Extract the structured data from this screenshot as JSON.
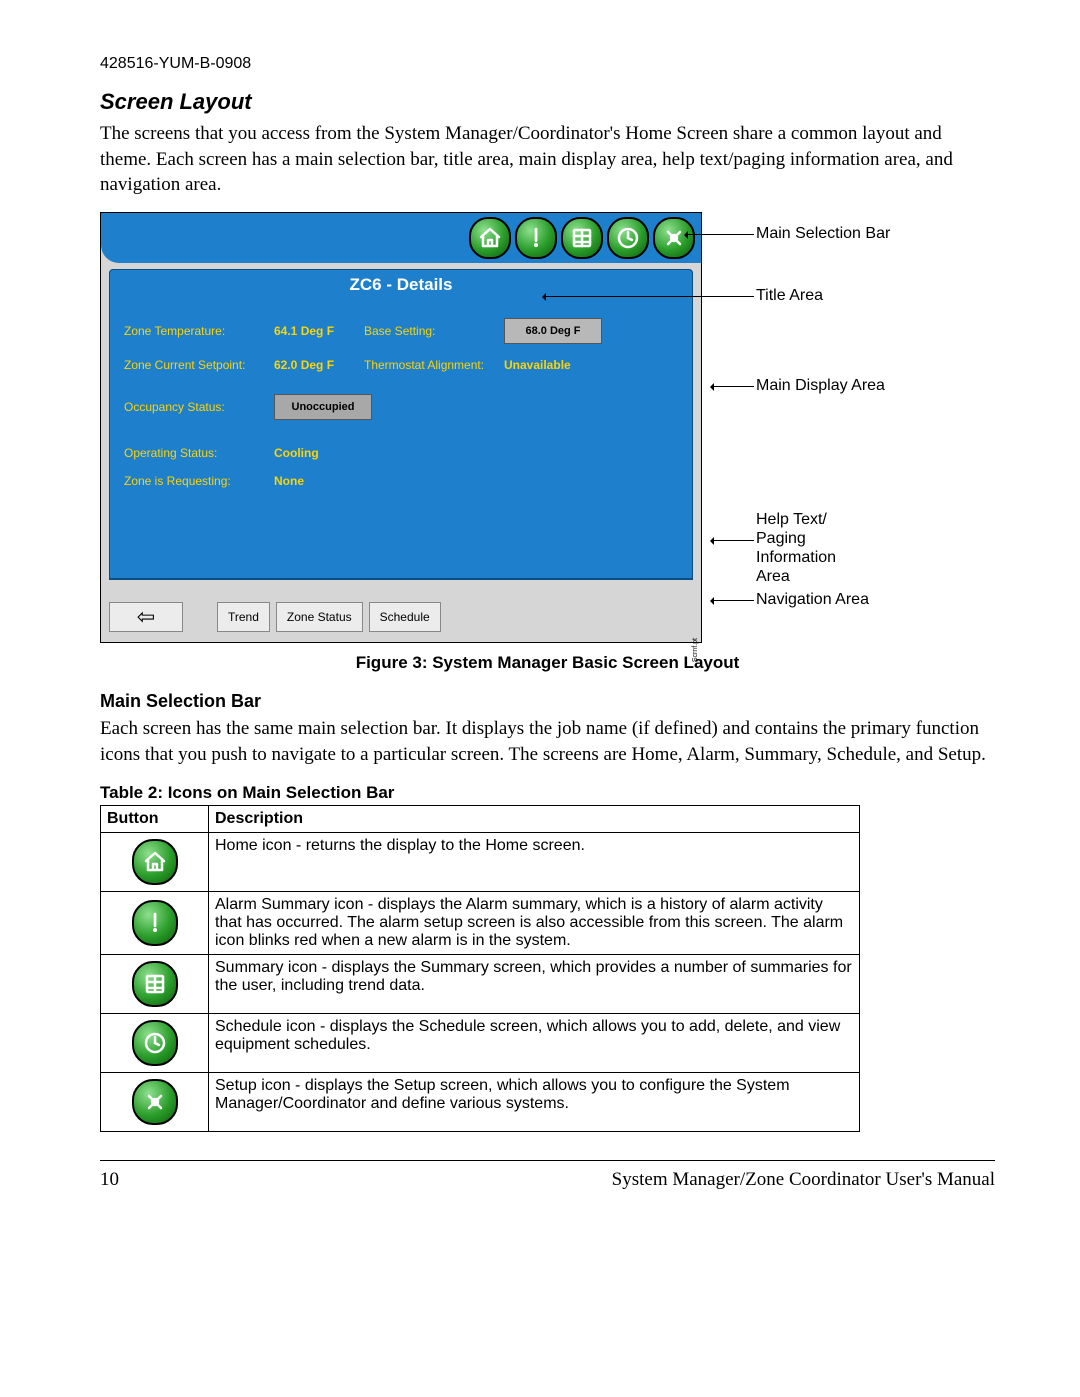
{
  "doc_header": "428516-YUM-B-0908",
  "section_heading": "Screen Layout",
  "intro_paragraph": "The screens that you access from the System Manager/Coordinator's Home Screen share a common layout and theme. Each screen has a main selection bar, title area, main display area, help text/paging information area, and navigation area.",
  "figure": {
    "title_bar_text": "ZC6 - Details",
    "annotations": {
      "main_selection_bar": "Main Selection Bar",
      "title_area": "Title Area",
      "main_display_area": "Main Display Area",
      "help_text_area": "Help Text/ Paging Information Area",
      "navigation_area": "Navigation Area"
    },
    "fields": {
      "zone_temp_label": "Zone Temperature:",
      "zone_temp_value": "64.1 Deg F",
      "base_setting_label": "Base Setting:",
      "base_setting_value": "68.0 Deg F",
      "zone_setpoint_label": "Zone Current Setpoint:",
      "zone_setpoint_value": "62.0 Deg F",
      "therm_align_label": "Thermostat Alignment:",
      "therm_align_value": "Unavailable",
      "occupancy_label": "Occupancy Status:",
      "occupancy_value": "Unoccupied",
      "operating_label": "Operating Status:",
      "operating_value": "Cooling",
      "requesting_label": "Zone is Requesting:",
      "requesting_value": "None"
    },
    "nav": {
      "trend": "Trend",
      "zone_status": "Zone Status",
      "schedule": "Schedule"
    },
    "watermark": "Scrnf.pt",
    "caption": "Figure 3: System Manager Basic Screen Layout"
  },
  "subsection_heading": "Main Selection Bar",
  "subsection_paragraph": "Each screen has the same main selection bar. It displays the job name (if defined) and contains the primary function icons that you push to navigate to a particular screen. The screens are Home, Alarm, Summary, Schedule, and Setup.",
  "table_caption": "Table 2: Icons on Main Selection Bar",
  "table": {
    "col1": "Button",
    "col2": "Description",
    "rows": [
      {
        "icon": "home",
        "desc": "Home icon - returns the display to the Home screen."
      },
      {
        "icon": "alarm",
        "desc": "Alarm Summary icon - displays the Alarm summary, which is a history of alarm activity that has occurred. The alarm setup screen is also accessible from this screen. The alarm icon blinks red when a new alarm is in the system."
      },
      {
        "icon": "summary",
        "desc": "Summary icon - displays the Summary screen, which provides a number of summaries for the user, including trend data."
      },
      {
        "icon": "schedule",
        "desc": "Schedule icon - displays the Schedule screen, which allows you to add, delete, and view equipment schedules."
      },
      {
        "icon": "setup",
        "desc": "Setup icon - displays the Setup screen, which allows you to configure the System Manager/Coordinator and define various systems."
      }
    ]
  },
  "footer": {
    "page": "10",
    "title": "System Manager/Zone Coordinator User's Manual"
  }
}
